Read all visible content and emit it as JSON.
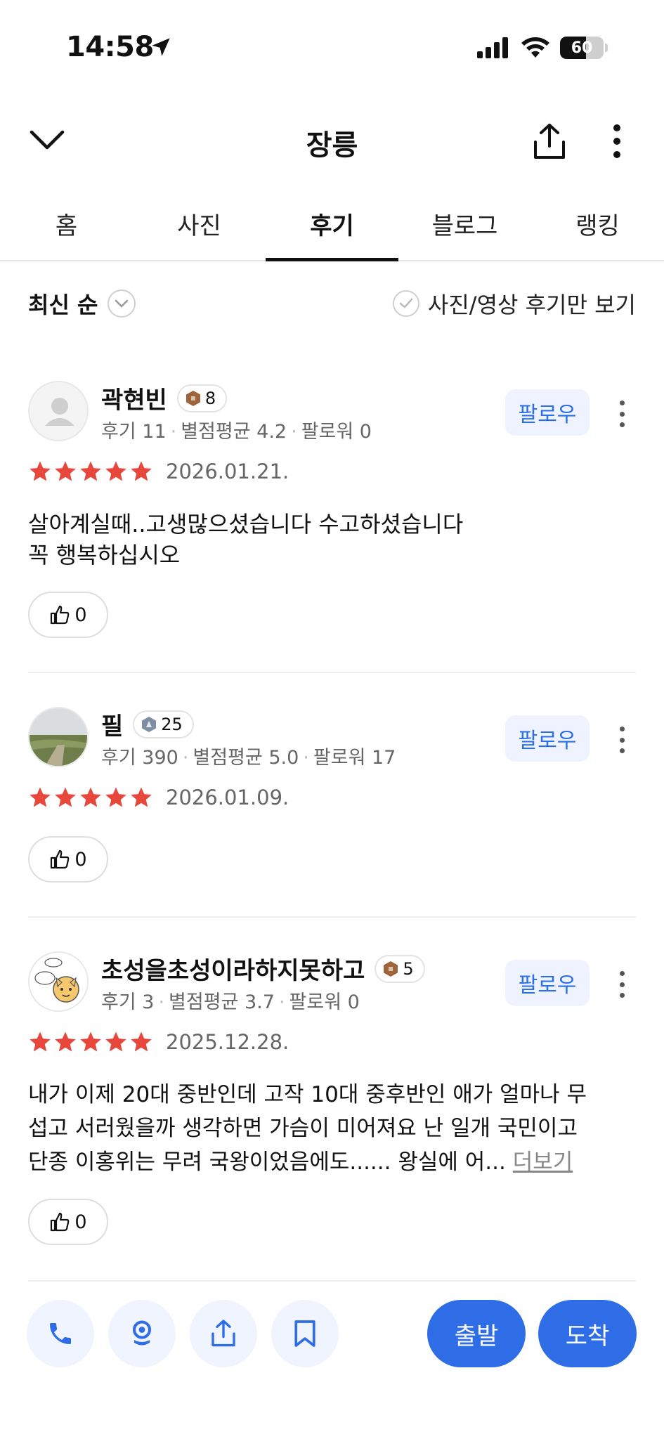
{
  "status": {
    "time": "14:58",
    "battery": "60",
    "battery_level": 0.6
  },
  "header": {
    "title": "장릉"
  },
  "tabs": [
    {
      "label": "홈"
    },
    {
      "label": "사진"
    },
    {
      "label": "후기"
    },
    {
      "label": "블로그"
    },
    {
      "label": "랭킹"
    }
  ],
  "active_tab": "후기",
  "filter": {
    "sort_label": "최신 순",
    "photo_only_label": "사진/영상 후기만 보기"
  },
  "reviews": [
    {
      "name": "곽현빈",
      "badge_level": "8",
      "meta": {
        "reviews": "후기 11",
        "avg": "별점평균 4.2",
        "followers": "팔로워 0"
      },
      "follow_label": "팔로우",
      "rating": 5,
      "date": "2026.01.21.",
      "text_lines": [
        "살아계실때..고생많으셨습니다 수고하셨습니다",
        "꼭 행복하십시오"
      ],
      "likes": "0"
    },
    {
      "name": "필",
      "badge_level": "25",
      "meta": {
        "reviews": "후기 390",
        "avg": "별점평균 5.0",
        "followers": "팔로워 17"
      },
      "follow_label": "팔로우",
      "rating": 5,
      "date": "2026.01.09.",
      "text_lines": [],
      "likes": "0"
    },
    {
      "name": "초성을초성이라하지못하고",
      "badge_level": "5",
      "meta": {
        "reviews": "후기 3",
        "avg": "별점평균 3.7",
        "followers": "팔로워 0"
      },
      "follow_label": "팔로우",
      "rating": 5,
      "date": "2025.12.28.",
      "text_lines": [
        "내가 이제 20대 중반인데 고작 10대 중후반인 애가 얼마나 무",
        "섭고 서러웠을까 생각하면 가슴이 미어져요 난 일개 국민이고",
        "단종 이홍위는 무려 국왕이었음에도...... 왕실에 어..."
      ],
      "more_label": "더보기",
      "likes": "0"
    }
  ],
  "bottom_bar": {
    "depart_label": "출발",
    "arrive_label": "도착"
  },
  "colors": {
    "accent": "#2f6de6",
    "star": "#e8473c",
    "follow_bg": "#eef3ff",
    "follow_text": "#2b6fe8"
  },
  "icons": [
    "location-arrow-icon",
    "signal-icon",
    "wifi-icon",
    "battery-icon",
    "chevron-down-icon",
    "share-icon",
    "more-vertical-icon",
    "check-circle-icon",
    "star-icon",
    "thumbs-up-icon",
    "phone-icon",
    "street-view-icon",
    "bookmark-icon"
  ]
}
